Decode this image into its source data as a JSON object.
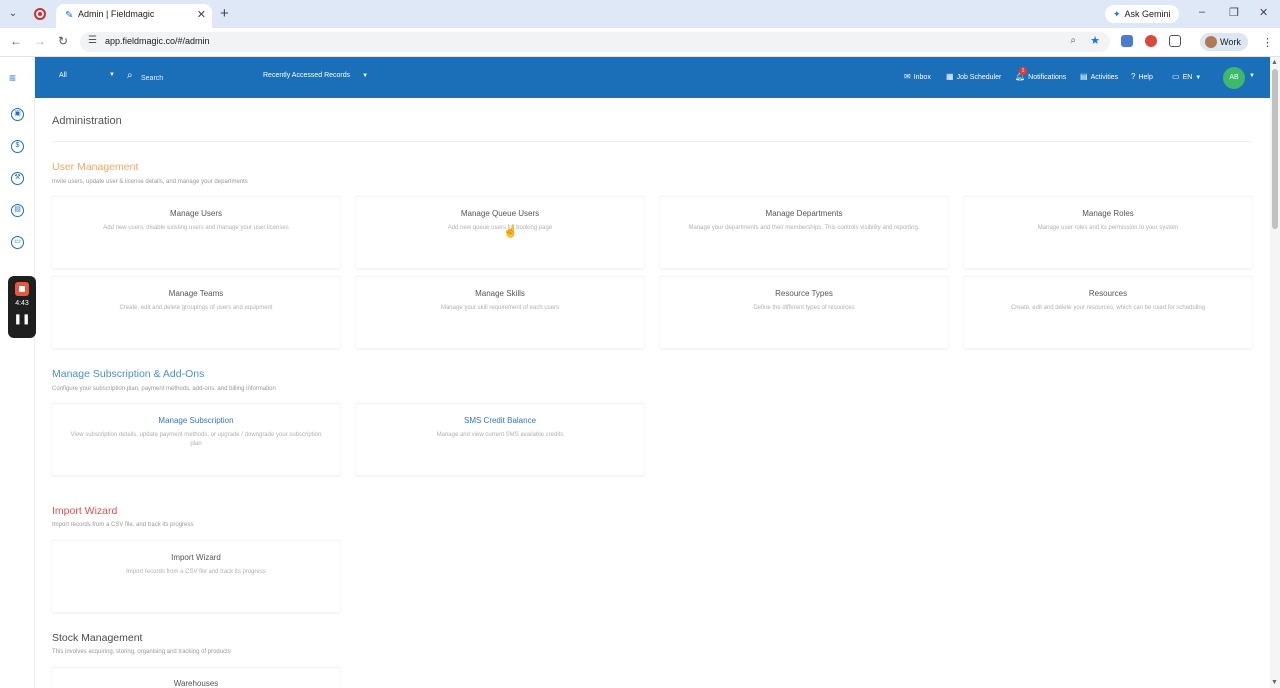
{
  "browser": {
    "tab_title": "Admin | Fieldmagic",
    "url": "app.fieldmagic.co/#/admin",
    "ask_gemini": "Ask Gemini",
    "profile": "Work"
  },
  "appbar": {
    "scope": "All",
    "search_placeholder": "Search",
    "recent_records": "Recently Accessed Records",
    "nav": {
      "inbox": "Inbox",
      "job_scheduler": "Job Scheduler",
      "notifications": "Notifications",
      "notifications_count": "1",
      "activities": "Activities",
      "help": "Help",
      "language": "EN"
    },
    "avatar_initials": "AB",
    "brand_color": "#1b6fb8"
  },
  "recorder": {
    "time": "4:43"
  },
  "page": {
    "title": "Administration",
    "sections": [
      {
        "title": "User Management",
        "description": "Invite users, update user & license details, and manage your departments",
        "title_color": "#f0a868",
        "cards": [
          {
            "title": "Manage Users",
            "description": "Add new users, disable existing users and manage your user licenses"
          },
          {
            "title": "Manage Queue Users",
            "description": "Add new queue users for booking page"
          },
          {
            "title": "Manage Departments",
            "description": "Manage your departments and their memberships. This controls visibility and reporting."
          },
          {
            "title": "Manage Roles",
            "description": "Manage user roles and its permission to your system"
          },
          {
            "title": "Manage Teams",
            "description": "Create, edit and delete groupings of users and equipment"
          },
          {
            "title": "Manage Skills",
            "description": "Manage your skill requirement of each users"
          },
          {
            "title": "Resource Types",
            "description": "Define the different types of resources"
          },
          {
            "title": "Resources",
            "description": "Create, edit and delete your resources, which can be used for scheduling"
          }
        ]
      },
      {
        "title": "Manage Subscription & Add-Ons",
        "description": "Configure your subscription plan, payment methods, add-ons, and billing information",
        "title_color": "#4a90c8",
        "cards": [
          {
            "title": "Manage Subscription",
            "description": "View subscription details, update payment methods, or upgrade / downgrade your subscription plan"
          },
          {
            "title": "SMS Credit Balance",
            "description": "Manage and view current SMS available credits"
          }
        ]
      },
      {
        "title": "Import Wizard",
        "description": "Import records from a CSV file, and track its progress",
        "title_color": "#d9534f",
        "cards": [
          {
            "title": "Import Wizard",
            "description": "Import records from a CSV file and track its progress"
          }
        ]
      },
      {
        "title": "Stock Management",
        "description": "This involves acquiring, storing, organising and tracking of products",
        "title_color": "#4a4a4a",
        "cards": [
          {
            "title": "Warehouses",
            "description": ""
          }
        ]
      }
    ]
  }
}
